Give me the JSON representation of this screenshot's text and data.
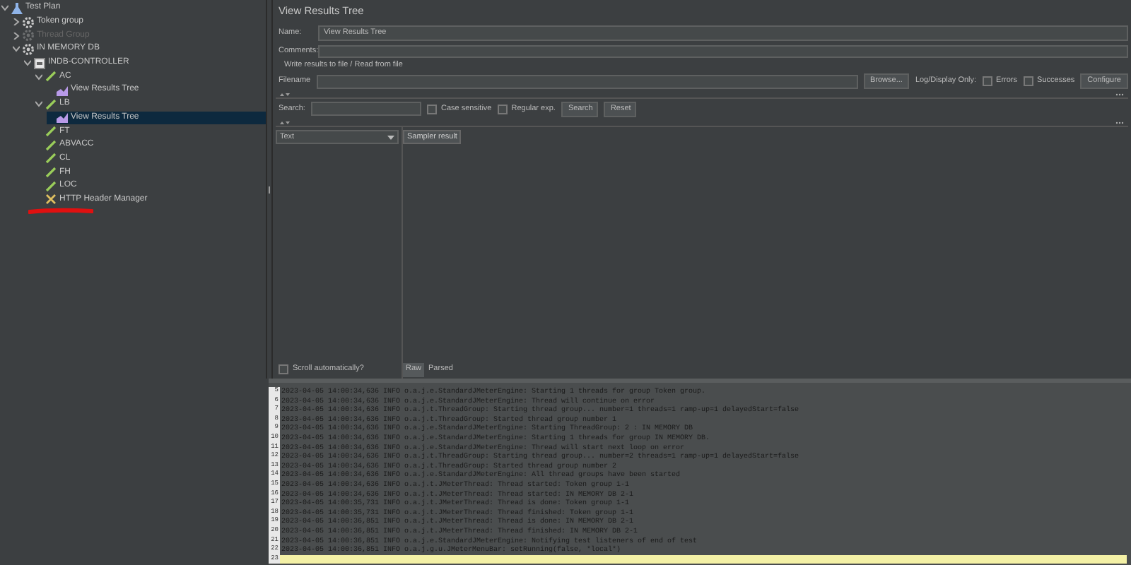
{
  "tree": [
    {
      "label": "Test Plan",
      "kind": "plan",
      "expanded": true,
      "selected": false,
      "disabled": false,
      "children": [
        {
          "label": "Token group",
          "kind": "group",
          "expanded": false,
          "selected": false,
          "disabled": false
        },
        {
          "label": "Thread Group",
          "kind": "group",
          "expanded": false,
          "selected": false,
          "disabled": true
        },
        {
          "label": "IN MEMORY DB",
          "kind": "group",
          "expanded": true,
          "selected": false,
          "disabled": false,
          "children": [
            {
              "label": "INDB-CONTROLLER",
              "kind": "controller",
              "expanded": true,
              "selected": false,
              "disabled": false,
              "children": [
                {
                  "label": "AC",
                  "kind": "sampler",
                  "expanded": true,
                  "selected": false,
                  "disabled": false,
                  "children": [
                    {
                      "label": "View Results Tree",
                      "kind": "listener",
                      "selected": false,
                      "disabled": false
                    }
                  ]
                },
                {
                  "label": "LB",
                  "kind": "sampler",
                  "expanded": true,
                  "selected": false,
                  "disabled": false,
                  "children": [
                    {
                      "label": "View Results Tree",
                      "kind": "listener",
                      "selected": true,
                      "disabled": false
                    }
                  ]
                },
                {
                  "label": "FT",
                  "kind": "sampler",
                  "selected": false,
                  "disabled": false
                },
                {
                  "label": "ABVACC",
                  "kind": "sampler",
                  "selected": false,
                  "disabled": false
                },
                {
                  "label": "CL",
                  "kind": "sampler",
                  "selected": false,
                  "disabled": false
                },
                {
                  "label": "FH",
                  "kind": "sampler",
                  "selected": false,
                  "disabled": false
                },
                {
                  "label": "LOC",
                  "kind": "sampler",
                  "selected": false,
                  "disabled": false
                },
                {
                  "label": "HTTP Header Manager",
                  "kind": "config",
                  "selected": false,
                  "disabled": false
                }
              ]
            }
          ]
        }
      ]
    }
  ],
  "panel": {
    "title": "View Results Tree",
    "name": {
      "label": "Name:",
      "value": "View Results Tree"
    },
    "comments": {
      "label": "Comments:"
    },
    "file_section": "Write results to file / Read from file",
    "filename": {
      "label": "Filename"
    },
    "browse": "Browse...",
    "log_display_only": "Log/Display Only:",
    "errors": {
      "label": "Errors",
      "checked": false
    },
    "successes": {
      "label": "Successes",
      "checked": false
    },
    "configure": "Configure",
    "search": {
      "label": "Search:",
      "case_sensitive": {
        "label": "Case sensitive",
        "checked": false
      },
      "regular_exp": {
        "label": "Regular exp.",
        "checked": false
      },
      "search_button": "Search",
      "reset_button": "Reset"
    },
    "renderer": "Text",
    "result_tabs": [
      {
        "label": "Sampler result",
        "selected": true
      }
    ],
    "scroll_auto": {
      "label": "Scroll automatically?",
      "checked": false
    },
    "view_tabs": [
      {
        "label": "Raw",
        "selected": true
      },
      {
        "label": "Parsed",
        "selected": false
      }
    ]
  },
  "log": [
    {
      "n": "5",
      "text": "2023-04-05 14:00:34,636 INFO o.a.j.e.StandardJMeterEngine: Starting 1 threads for group Token group."
    },
    {
      "n": "6",
      "text": "2023-04-05 14:00:34,636 INFO o.a.j.e.StandardJMeterEngine: Thread will continue on error"
    },
    {
      "n": "7",
      "text": "2023-04-05 14:00:34,636 INFO o.a.j.t.ThreadGroup: Starting thread group... number=1 threads=1 ramp-up=1 delayedStart=false"
    },
    {
      "n": "8",
      "text": "2023-04-05 14:00:34,636 INFO o.a.j.t.ThreadGroup: Started thread group number 1"
    },
    {
      "n": "9",
      "text": "2023-04-05 14:00:34,636 INFO o.a.j.e.StandardJMeterEngine: Starting ThreadGroup: 2 : IN MEMORY DB"
    },
    {
      "n": "10",
      "text": "2023-04-05 14:00:34,636 INFO o.a.j.e.StandardJMeterEngine: Starting 1 threads for group IN MEMORY DB."
    },
    {
      "n": "11",
      "text": "2023-04-05 14:00:34,636 INFO o.a.j.e.StandardJMeterEngine: Thread will start next loop on error"
    },
    {
      "n": "12",
      "text": "2023-04-05 14:00:34,636 INFO o.a.j.t.ThreadGroup: Starting thread group... number=2 threads=1 ramp-up=1 delayedStart=false"
    },
    {
      "n": "13",
      "text": "2023-04-05 14:00:34,636 INFO o.a.j.t.ThreadGroup: Started thread group number 2"
    },
    {
      "n": "14",
      "text": "2023-04-05 14:00:34,636 INFO o.a.j.e.StandardJMeterEngine: All thread groups have been started"
    },
    {
      "n": "15",
      "text": "2023-04-05 14:00:34,636 INFO o.a.j.t.JMeterThread: Thread started: Token group 1-1"
    },
    {
      "n": "16",
      "text": "2023-04-05 14:00:34,636 INFO o.a.j.t.JMeterThread: Thread started: IN MEMORY DB 2-1"
    },
    {
      "n": "17",
      "text": "2023-04-05 14:00:35,731 INFO o.a.j.t.JMeterThread: Thread is done: Token group 1-1"
    },
    {
      "n": "18",
      "text": "2023-04-05 14:00:35,731 INFO o.a.j.t.JMeterThread: Thread finished: Token group 1-1"
    },
    {
      "n": "19",
      "text": "2023-04-05 14:00:36,851 INFO o.a.j.t.JMeterThread: Thread is done: IN MEMORY DB 2-1"
    },
    {
      "n": "20",
      "text": "2023-04-05 14:00:36,851 INFO o.a.j.t.JMeterThread: Thread finished: IN MEMORY DB 2-1"
    },
    {
      "n": "21",
      "text": "2023-04-05 14:00:36,851 INFO o.a.j.e.StandardJMeterEngine: Notifying test listeners of end of test"
    },
    {
      "n": "22",
      "text": "2023-04-05 14:00:36,851 INFO o.a.j.g.u.JMeterMenuBar: setRunning(false, *local*)"
    },
    {
      "n": "23",
      "current": true
    }
  ]
}
